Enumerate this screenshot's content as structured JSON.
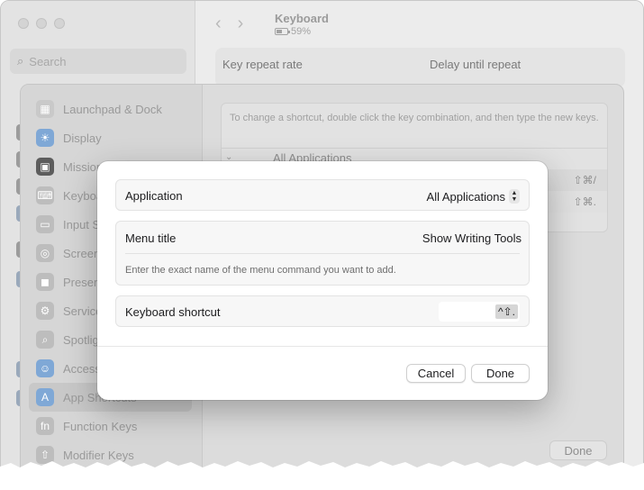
{
  "background_window": {
    "search_placeholder": "Search",
    "title": "Keyboard",
    "battery_percent": "59%",
    "key_repeat_label": "Key repeat rate",
    "delay_label": "Delay until repeat"
  },
  "shortcuts_sheet": {
    "sidebar_items": [
      {
        "label": "Launchpad & Dock",
        "icon": "launchpad-icon",
        "color": "#c9c9c9",
        "glyph": "▦"
      },
      {
        "label": "Display",
        "icon": "display-icon",
        "color": "#7fa8d6",
        "glyph": "☀"
      },
      {
        "label": "Mission Control",
        "icon": "mission-control-icon",
        "color": "#5d5d5d",
        "glyph": "▣"
      },
      {
        "label": "Keyboard",
        "icon": "keyboard-icon",
        "color": "#bdbdbd",
        "glyph": "⌨"
      },
      {
        "label": "Input Sources",
        "icon": "input-sources-icon",
        "color": "#bdbdbd",
        "glyph": "▭"
      },
      {
        "label": "Screenshots",
        "icon": "screenshot-icon",
        "color": "#bdbdbd",
        "glyph": "◎"
      },
      {
        "label": "Presenter Overlay",
        "icon": "presenter-icon",
        "color": "#bdbdbd",
        "glyph": "◼"
      },
      {
        "label": "Services",
        "icon": "services-icon",
        "color": "#bdbdbd",
        "glyph": "⚙"
      },
      {
        "label": "Spotlight",
        "icon": "spotlight-icon",
        "color": "#bdbdbd",
        "glyph": "⌕"
      },
      {
        "label": "Accessibility",
        "icon": "accessibility-icon",
        "color": "#7fa8d6",
        "glyph": "☺"
      },
      {
        "label": "App Shortcuts",
        "icon": "app-shortcuts-icon",
        "color": "#7fa8d6",
        "glyph": "A"
      },
      {
        "label": "Function Keys",
        "icon": "function-keys-icon",
        "color": "#bdbdbd",
        "glyph": "fn"
      },
      {
        "label": "Modifier Keys",
        "icon": "modifier-keys-icon",
        "color": "#bdbdbd",
        "glyph": "⇧"
      }
    ],
    "instructions": "To change a shortcut, double click the key combination, and then type the new keys.",
    "all_apps_label": "All Applications",
    "shortcuts": [
      "⇧⌘/",
      "⇧⌘."
    ],
    "done_label": "Done"
  },
  "dialog": {
    "application_label": "Application",
    "application_value": "All Applications",
    "menu_title_label": "Menu title",
    "menu_title_value": "Show Writing Tools",
    "menu_hint": "Enter the exact name of the menu command you want to add.",
    "keyboard_shortcut_label": "Keyboard shortcut",
    "keyboard_shortcut_value": "^⇧.",
    "cancel_label": "Cancel",
    "done_label": "Done"
  }
}
